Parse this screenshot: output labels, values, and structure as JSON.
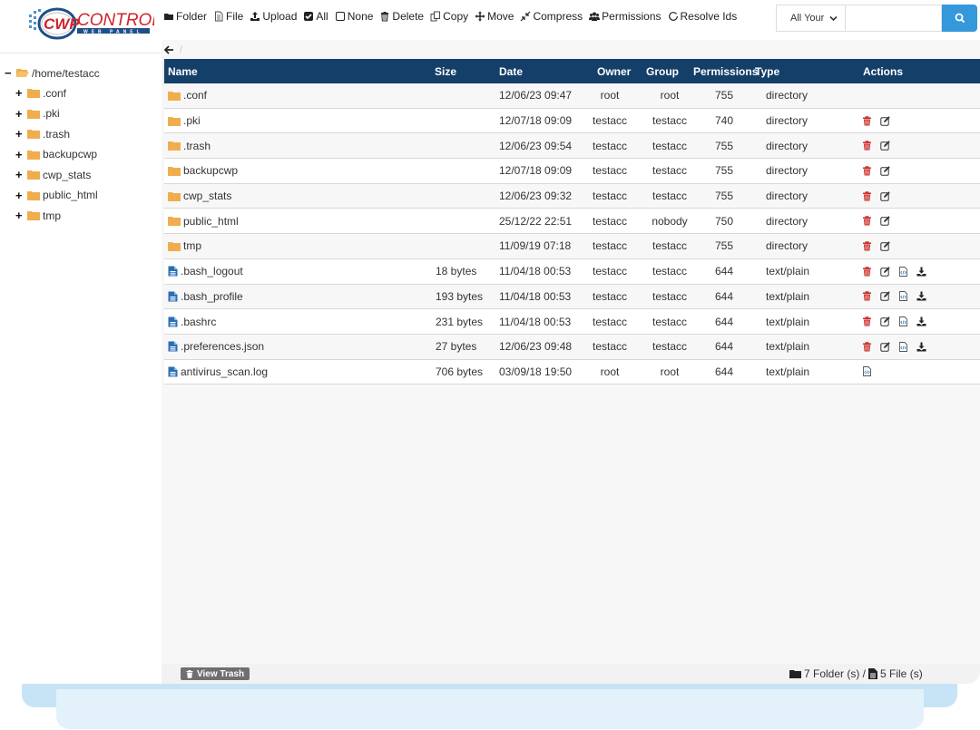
{
  "logo": {
    "brand": "CWP",
    "text": "CONTROL",
    "subtitle": "WEB PANEL"
  },
  "toolbar": {
    "folder": "Folder",
    "file": "File",
    "upload": "Upload",
    "all": "All",
    "none": "None",
    "delete": "Delete",
    "copy": "Copy",
    "move": "Move",
    "compress": "Compress",
    "permissions": "Permissions",
    "resolve_ids": "Resolve Ids"
  },
  "search": {
    "scope_selected": "All Your",
    "value": "",
    "placeholder": ""
  },
  "tree": {
    "root": "/home/testacc",
    "items": [
      ".conf",
      ".pki",
      ".trash",
      "backupcwp",
      "cwp_stats",
      "public_html",
      "tmp"
    ]
  },
  "breadcrumb": {
    "separator": "/"
  },
  "table": {
    "headers": {
      "name": "Name",
      "size": "Size",
      "date": "Date",
      "owner": "Owner",
      "group": "Group",
      "permissions": "Permissions",
      "type": "Type",
      "actions": "Actions"
    },
    "rows": [
      {
        "name": ".conf",
        "kind": "folder",
        "size": "",
        "date": "12/06/23 09:47",
        "owner": "root",
        "group": "root",
        "perm": "755",
        "type": "directory",
        "actions": []
      },
      {
        "name": ".pki",
        "kind": "folder",
        "size": "",
        "date": "12/07/18 09:09",
        "owner": "testacc",
        "group": "testacc",
        "perm": "740",
        "type": "directory",
        "actions": [
          "delete",
          "rename"
        ]
      },
      {
        "name": ".trash",
        "kind": "folder",
        "size": "",
        "date": "12/06/23 09:54",
        "owner": "testacc",
        "group": "testacc",
        "perm": "755",
        "type": "directory",
        "actions": [
          "delete",
          "rename"
        ]
      },
      {
        "name": "backupcwp",
        "kind": "folder",
        "size": "",
        "date": "12/07/18 09:09",
        "owner": "testacc",
        "group": "testacc",
        "perm": "755",
        "type": "directory",
        "actions": [
          "delete",
          "rename"
        ]
      },
      {
        "name": "cwp_stats",
        "kind": "folder",
        "size": "",
        "date": "12/06/23 09:32",
        "owner": "testacc",
        "group": "testacc",
        "perm": "755",
        "type": "directory",
        "actions": [
          "delete",
          "rename"
        ]
      },
      {
        "name": "public_html",
        "kind": "folder",
        "size": "",
        "date": "25/12/22 22:51",
        "owner": "testacc",
        "group": "nobody",
        "perm": "750",
        "type": "directory",
        "actions": [
          "delete",
          "rename"
        ]
      },
      {
        "name": "tmp",
        "kind": "folder",
        "size": "",
        "date": "11/09/19 07:18",
        "owner": "testacc",
        "group": "testacc",
        "perm": "755",
        "type": "directory",
        "actions": [
          "delete",
          "rename"
        ]
      },
      {
        "name": ".bash_logout",
        "kind": "file",
        "size": "18 bytes",
        "date": "11/04/18 00:53",
        "owner": "testacc",
        "group": "testacc",
        "perm": "644",
        "type": "text/plain",
        "actions": [
          "delete",
          "rename",
          "edit-code",
          "download"
        ]
      },
      {
        "name": ".bash_profile",
        "kind": "file",
        "size": "193 bytes",
        "date": "11/04/18 00:53",
        "owner": "testacc",
        "group": "testacc",
        "perm": "644",
        "type": "text/plain",
        "actions": [
          "delete",
          "rename",
          "edit-code",
          "download"
        ]
      },
      {
        "name": ".bashrc",
        "kind": "file",
        "size": "231 bytes",
        "date": "11/04/18 00:53",
        "owner": "testacc",
        "group": "testacc",
        "perm": "644",
        "type": "text/plain",
        "actions": [
          "delete",
          "rename",
          "edit-code",
          "download"
        ]
      },
      {
        "name": ".preferences.json",
        "kind": "file",
        "size": "27 bytes",
        "date": "12/06/23 09:48",
        "owner": "testacc",
        "group": "testacc",
        "perm": "644",
        "type": "text/plain",
        "actions": [
          "delete",
          "rename",
          "edit-code",
          "download"
        ]
      },
      {
        "name": "antivirus_scan.log",
        "kind": "file",
        "size": "706 bytes",
        "date": "03/09/18 19:50",
        "owner": "root",
        "group": "root",
        "perm": "644",
        "type": "text/plain",
        "actions": [
          "edit-code"
        ]
      }
    ]
  },
  "footer": {
    "view_trash": "View Trash",
    "folders_count": "7 Folder (s) /",
    "files_count": "5 File (s)"
  },
  "colors": {
    "header_bg": "#143f69",
    "accent": "#3498db",
    "folder": "#f0ad4e",
    "file": "#2a6fb5",
    "delete": "#c9302c"
  }
}
